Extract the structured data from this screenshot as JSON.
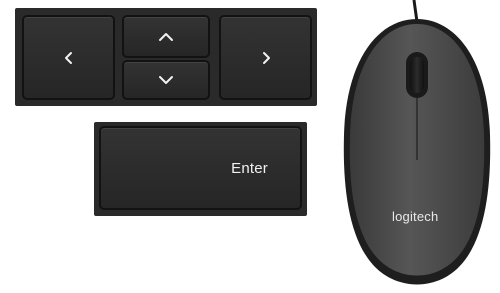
{
  "keys": {
    "left": {
      "icon": "chevron-left-icon"
    },
    "up": {
      "icon": "chevron-up-icon"
    },
    "down": {
      "icon": "chevron-down-icon"
    },
    "right": {
      "icon": "chevron-right-icon"
    },
    "enter": {
      "label": "Enter"
    }
  },
  "mouse": {
    "logo": "logitech"
  },
  "colors": {
    "key_face": "#2e2e2e",
    "key_border": "#121212",
    "key_text": "#f2f2f2",
    "mouse_body": "#4a4a4a",
    "mouse_base": "#1e1e1e"
  }
}
